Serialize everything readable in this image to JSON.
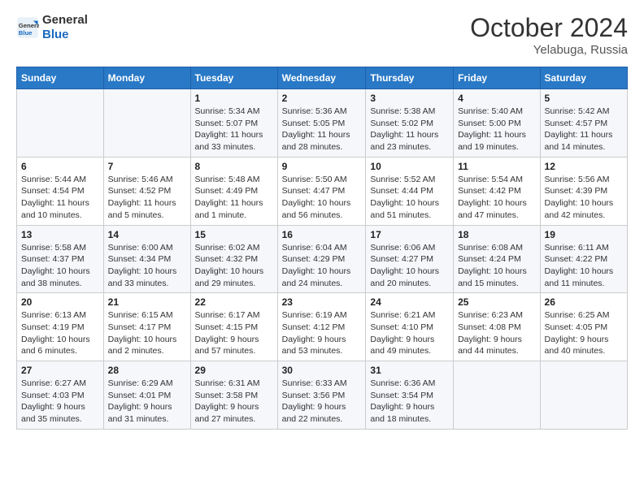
{
  "logo": {
    "line1": "General",
    "line2": "Blue"
  },
  "title": {
    "month": "October 2024",
    "location": "Yelabuga, Russia"
  },
  "headers": [
    "Sunday",
    "Monday",
    "Tuesday",
    "Wednesday",
    "Thursday",
    "Friday",
    "Saturday"
  ],
  "weeks": [
    [
      {
        "day": "",
        "info": ""
      },
      {
        "day": "",
        "info": ""
      },
      {
        "day": "1",
        "info": "Sunrise: 5:34 AM\nSunset: 5:07 PM\nDaylight: 11 hours and 33 minutes."
      },
      {
        "day": "2",
        "info": "Sunrise: 5:36 AM\nSunset: 5:05 PM\nDaylight: 11 hours and 28 minutes."
      },
      {
        "day": "3",
        "info": "Sunrise: 5:38 AM\nSunset: 5:02 PM\nDaylight: 11 hours and 23 minutes."
      },
      {
        "day": "4",
        "info": "Sunrise: 5:40 AM\nSunset: 5:00 PM\nDaylight: 11 hours and 19 minutes."
      },
      {
        "day": "5",
        "info": "Sunrise: 5:42 AM\nSunset: 4:57 PM\nDaylight: 11 hours and 14 minutes."
      }
    ],
    [
      {
        "day": "6",
        "info": "Sunrise: 5:44 AM\nSunset: 4:54 PM\nDaylight: 11 hours and 10 minutes."
      },
      {
        "day": "7",
        "info": "Sunrise: 5:46 AM\nSunset: 4:52 PM\nDaylight: 11 hours and 5 minutes."
      },
      {
        "day": "8",
        "info": "Sunrise: 5:48 AM\nSunset: 4:49 PM\nDaylight: 11 hours and 1 minute."
      },
      {
        "day": "9",
        "info": "Sunrise: 5:50 AM\nSunset: 4:47 PM\nDaylight: 10 hours and 56 minutes."
      },
      {
        "day": "10",
        "info": "Sunrise: 5:52 AM\nSunset: 4:44 PM\nDaylight: 10 hours and 51 minutes."
      },
      {
        "day": "11",
        "info": "Sunrise: 5:54 AM\nSunset: 4:42 PM\nDaylight: 10 hours and 47 minutes."
      },
      {
        "day": "12",
        "info": "Sunrise: 5:56 AM\nSunset: 4:39 PM\nDaylight: 10 hours and 42 minutes."
      }
    ],
    [
      {
        "day": "13",
        "info": "Sunrise: 5:58 AM\nSunset: 4:37 PM\nDaylight: 10 hours and 38 minutes."
      },
      {
        "day": "14",
        "info": "Sunrise: 6:00 AM\nSunset: 4:34 PM\nDaylight: 10 hours and 33 minutes."
      },
      {
        "day": "15",
        "info": "Sunrise: 6:02 AM\nSunset: 4:32 PM\nDaylight: 10 hours and 29 minutes."
      },
      {
        "day": "16",
        "info": "Sunrise: 6:04 AM\nSunset: 4:29 PM\nDaylight: 10 hours and 24 minutes."
      },
      {
        "day": "17",
        "info": "Sunrise: 6:06 AM\nSunset: 4:27 PM\nDaylight: 10 hours and 20 minutes."
      },
      {
        "day": "18",
        "info": "Sunrise: 6:08 AM\nSunset: 4:24 PM\nDaylight: 10 hours and 15 minutes."
      },
      {
        "day": "19",
        "info": "Sunrise: 6:11 AM\nSunset: 4:22 PM\nDaylight: 10 hours and 11 minutes."
      }
    ],
    [
      {
        "day": "20",
        "info": "Sunrise: 6:13 AM\nSunset: 4:19 PM\nDaylight: 10 hours and 6 minutes."
      },
      {
        "day": "21",
        "info": "Sunrise: 6:15 AM\nSunset: 4:17 PM\nDaylight: 10 hours and 2 minutes."
      },
      {
        "day": "22",
        "info": "Sunrise: 6:17 AM\nSunset: 4:15 PM\nDaylight: 9 hours and 57 minutes."
      },
      {
        "day": "23",
        "info": "Sunrise: 6:19 AM\nSunset: 4:12 PM\nDaylight: 9 hours and 53 minutes."
      },
      {
        "day": "24",
        "info": "Sunrise: 6:21 AM\nSunset: 4:10 PM\nDaylight: 9 hours and 49 minutes."
      },
      {
        "day": "25",
        "info": "Sunrise: 6:23 AM\nSunset: 4:08 PM\nDaylight: 9 hours and 44 minutes."
      },
      {
        "day": "26",
        "info": "Sunrise: 6:25 AM\nSunset: 4:05 PM\nDaylight: 9 hours and 40 minutes."
      }
    ],
    [
      {
        "day": "27",
        "info": "Sunrise: 6:27 AM\nSunset: 4:03 PM\nDaylight: 9 hours and 35 minutes."
      },
      {
        "day": "28",
        "info": "Sunrise: 6:29 AM\nSunset: 4:01 PM\nDaylight: 9 hours and 31 minutes."
      },
      {
        "day": "29",
        "info": "Sunrise: 6:31 AM\nSunset: 3:58 PM\nDaylight: 9 hours and 27 minutes."
      },
      {
        "day": "30",
        "info": "Sunrise: 6:33 AM\nSunset: 3:56 PM\nDaylight: 9 hours and 22 minutes."
      },
      {
        "day": "31",
        "info": "Sunrise: 6:36 AM\nSunset: 3:54 PM\nDaylight: 9 hours and 18 minutes."
      },
      {
        "day": "",
        "info": ""
      },
      {
        "day": "",
        "info": ""
      }
    ]
  ]
}
